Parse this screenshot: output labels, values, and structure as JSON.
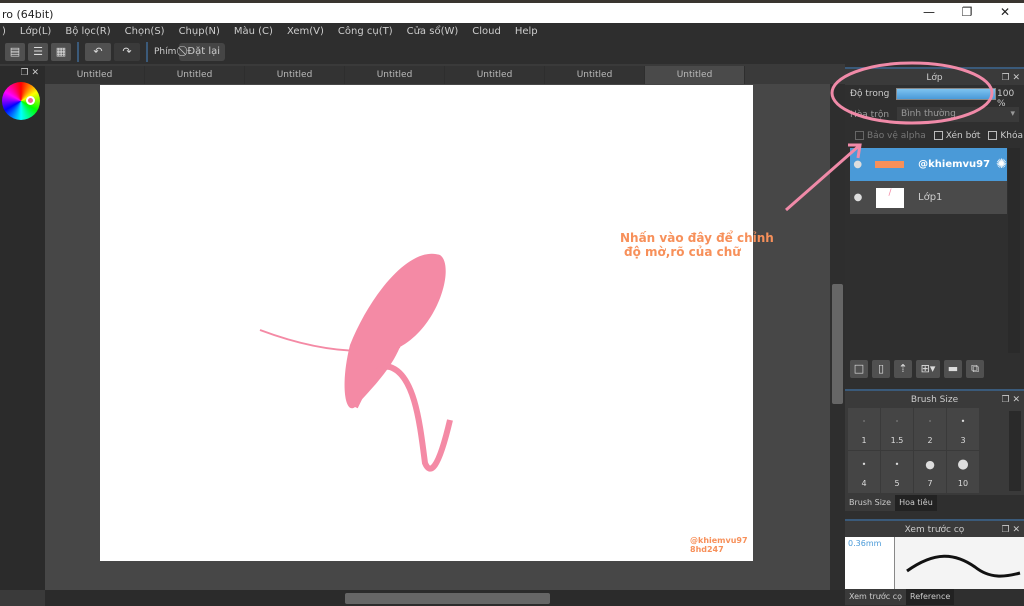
{
  "window": {
    "title": "ro (64bit)",
    "minimize": "—",
    "restore": "❐",
    "close": "✕"
  },
  "menu": [
    "Lớp(L)",
    "Bộ lọc(R)",
    "Chọn(S)",
    "Chụp(N)",
    "Màu (C)",
    "Xem(V)",
    "Công cụ(T)",
    "Cửa sổ(W)",
    "Cloud",
    "Help"
  ],
  "menu_partial": ")",
  "toolbar": {
    "key_label": "Phím",
    "reset_label": "Đặt lại"
  },
  "tabs": [
    "Untitled",
    "Untitled",
    "Untitled",
    "Untitled",
    "Untitled",
    "Untitled",
    "Untitled"
  ],
  "active_tab": 6,
  "layer_panel": {
    "title": "Lớp",
    "opacity_label": "Độ trong",
    "opacity_value": "100 %",
    "opacity": 100,
    "blend_label": "Hòa trộn",
    "blend_value": "Bình thường",
    "protect_alpha": "Bảo vệ alpha",
    "clip": "Xén bớt",
    "lock": "Khóa",
    "layers": [
      {
        "name": "@khiemvu97",
        "selected": true
      },
      {
        "name": "Lớp1",
        "selected": false
      }
    ]
  },
  "brush_size": {
    "title": "Brush Size",
    "sizes": [
      "1",
      "1.5",
      "2",
      "3",
      "4",
      "5",
      "7",
      "10"
    ],
    "tabs": [
      "Brush Size",
      "Hoa tiêu"
    ]
  },
  "brush_preview": {
    "title": "Xem trước cọ",
    "size": "0.36mm",
    "tabs": [
      "Xem trước cọ",
      "Reference"
    ]
  },
  "annotation": {
    "line1": "Nhấn vào đây để chỉnh",
    "line2": "độ mờ,rõ của chữ",
    "color": "#f7905a",
    "circle_color": "#f08aa8"
  },
  "watermark": {
    "line1": "@khiemvu97",
    "line2": "8hd247"
  },
  "accent": "#4a9ad8"
}
